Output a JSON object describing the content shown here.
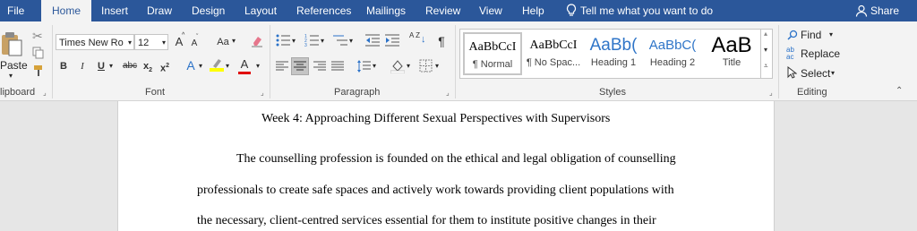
{
  "tabs": [
    "File",
    "Home",
    "Insert",
    "Draw",
    "Design",
    "Layout",
    "References",
    "Mailings",
    "Review",
    "View",
    "Help"
  ],
  "tell_me": "Tell me what you want to do",
  "share": "Share",
  "clipboard": {
    "paste_label": "Paste",
    "group_label": "lipboard"
  },
  "font": {
    "name": "Times New Ro",
    "size": "12",
    "group_label": "Font",
    "case_label": "Aa",
    "bold": "B",
    "italic": "I",
    "underline": "U",
    "strike": "abc",
    "subscript": "x",
    "superscript": "x",
    "grow": "A",
    "shrink": "A",
    "color_letter": "A",
    "effects": "A"
  },
  "paragraph": {
    "group_label": "Paragraph",
    "pilcrow": "¶",
    "sort": "A Z"
  },
  "styles": {
    "group_label": "Styles",
    "items": [
      {
        "sample": "AaBbCcI",
        "name": "¶ Normal"
      },
      {
        "sample": "AaBbCcI",
        "name": "¶ No Spac..."
      },
      {
        "sample": "AaBb(",
        "name": "Heading 1"
      },
      {
        "sample": "AaBbC(",
        "name": "Heading 2"
      },
      {
        "sample": "AaB",
        "name": "Title"
      }
    ]
  },
  "editing": {
    "group_label": "Editing",
    "find": "Find",
    "replace": "Replace",
    "select": "Select"
  },
  "document": {
    "title": "Week 4: Approaching Different Sexual Perspectives with Supervisors",
    "lines": [
      "The counselling profession is founded on the ethical and legal obligation of counselling",
      "professionals to create safe spaces and actively work towards providing client populations with",
      "the necessary, client-centred services essential for them to institute positive changes in their"
    ]
  },
  "colors": {
    "tabbar": "#2b579a",
    "ribbon": "#f3f3f3",
    "highlight": "#ffff00",
    "font_color": "#e00000"
  }
}
